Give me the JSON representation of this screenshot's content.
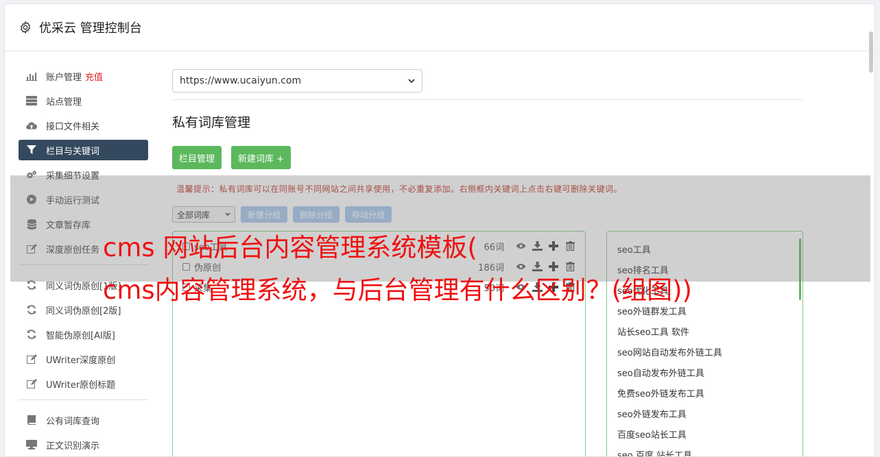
{
  "header": {
    "title": "优采云 管理控制台"
  },
  "sidebar": {
    "items": [
      {
        "label": "账户管理",
        "badge": "充值",
        "icon": "bar-chart-icon"
      },
      {
        "label": "站点管理",
        "icon": "server-icon"
      },
      {
        "label": "接口文件相关",
        "icon": "cloud-upload-icon"
      },
      {
        "label": "栏目与关键词",
        "icon": "filter-icon",
        "active": true
      },
      {
        "label": "采集细节设置",
        "icon": "cogs-icon"
      },
      {
        "label": "手动运行测试",
        "icon": "play-icon"
      },
      {
        "label": "文章暂存库",
        "icon": "database-icon"
      },
      {
        "label": "深度原创任务",
        "icon": "edit-icon"
      },
      {
        "label": "同义词伪原创[1版]",
        "icon": "refresh-icon"
      },
      {
        "label": "同义词伪原创[2版]",
        "icon": "refresh-icon"
      },
      {
        "label": "智能伪原创[AI版]",
        "icon": "refresh-icon"
      },
      {
        "label": "UWriter深度原创",
        "icon": "edit-icon"
      },
      {
        "label": "UWriter原创标题",
        "icon": "edit-icon"
      },
      {
        "label": "公有词库查询",
        "icon": "book-icon"
      },
      {
        "label": "正文识别演示",
        "icon": "monitor-icon"
      }
    ]
  },
  "main": {
    "site_select": "https://www.ucaiyun.com",
    "page_title": "私有词库管理",
    "buttons": {
      "column_manage": "栏目管理",
      "new_library": "新建词库 +"
    },
    "tip": "温馨提示：私有词库可以在同账号不同网站之间共享使用，不必重复添加。右侧框内关键词上点击右键可删除关键词。",
    "library_select": "全部词库",
    "group_buttons": {
      "new_group": "新建分组",
      "delete_group": "删除分组",
      "move_group": "移动分组"
    },
    "libraries": [
      {
        "name": "seo工具",
        "count": "66词"
      },
      {
        "name": "伪原创",
        "count": "186词"
      },
      {
        "name": "采集",
        "count": "50词"
      }
    ],
    "keywords": [
      "seo工具",
      "seo排名工具",
      "seo优化工具",
      "seo外链群发工具",
      "站长seo工具 软件",
      "seo网站自动发布外链工具",
      "seo自动发布外链工具",
      "免费seo外链发布工具",
      "seo外链发布工具",
      "百度seo站长工具",
      "seo 百度 站长工具"
    ]
  },
  "overlay": {
    "line1": "cms 网站后台内容管理系统模板(",
    "line2": "cms内容管理系统，与后台管理有什么区别？(组图))"
  }
}
